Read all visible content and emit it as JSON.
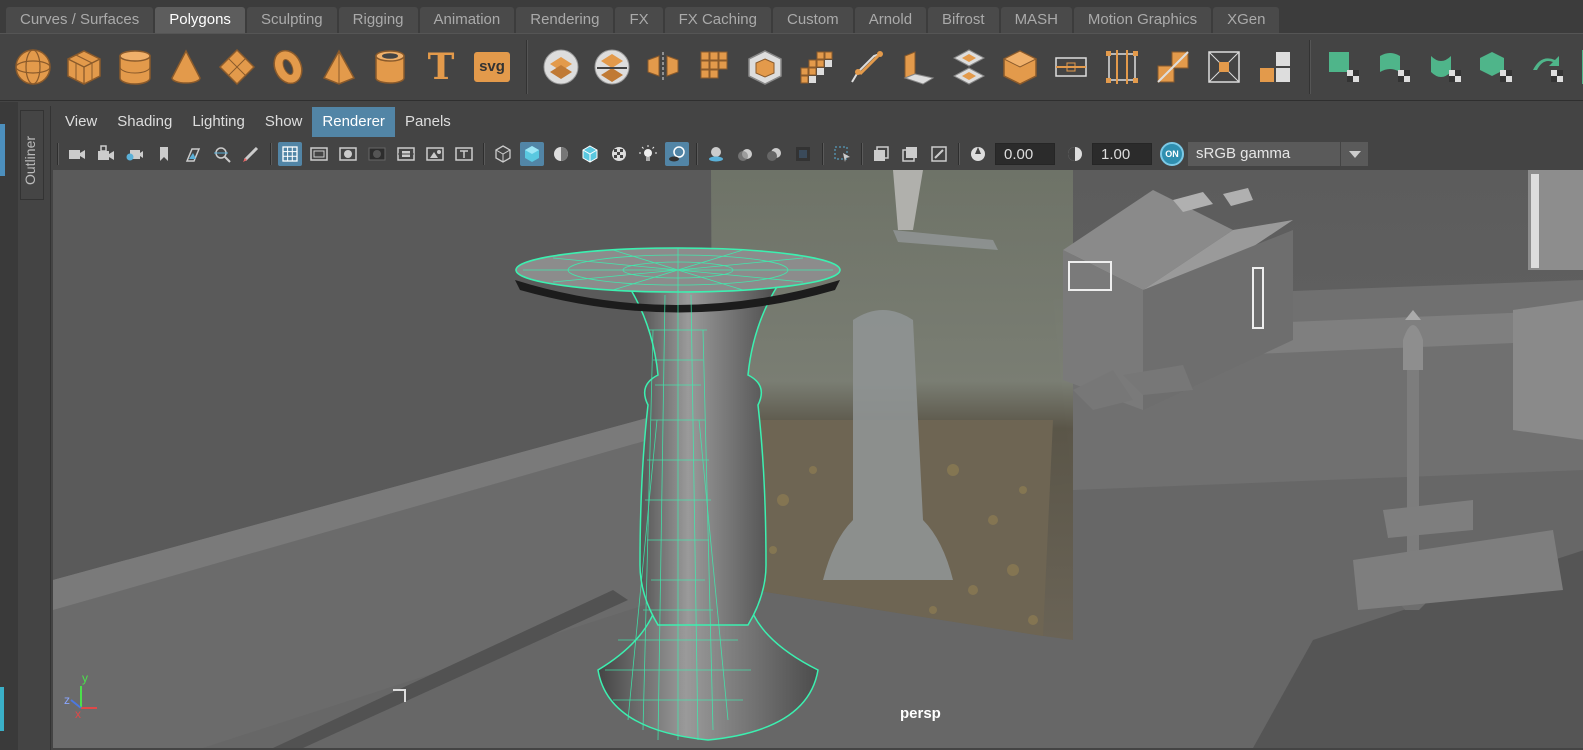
{
  "shelf_tabs": [
    "Curves / Surfaces",
    "Polygons",
    "Sculpting",
    "Rigging",
    "Animation",
    "Rendering",
    "FX",
    "FX Caching",
    "Custom",
    "Arnold",
    "Bifrost",
    "MASH",
    "Motion Graphics",
    "XGen"
  ],
  "active_shelf_tab": "Polygons",
  "shelf_icons": {
    "text_tool": "T",
    "svg_tool": "svg"
  },
  "outliner": {
    "label": "Outliner"
  },
  "panel_menu": [
    "View",
    "Shading",
    "Lighting",
    "Show",
    "Renderer",
    "Panels"
  ],
  "active_panel_menu": "Renderer",
  "toolbar": {
    "exposure": "0.00",
    "gamma": "1.00",
    "color_mgmt_badge": "ON",
    "view_transform": "sRGB gamma"
  },
  "viewport": {
    "camera_label": "persp",
    "axis_labels": {
      "x": "x",
      "y": "y",
      "z": "z"
    }
  },
  "colors": {
    "accent": "#5285a6",
    "shelf_icon": "#e39a4b",
    "shelf_icon_green": "#4fb58a",
    "wireframe": "#3cf0b0"
  }
}
